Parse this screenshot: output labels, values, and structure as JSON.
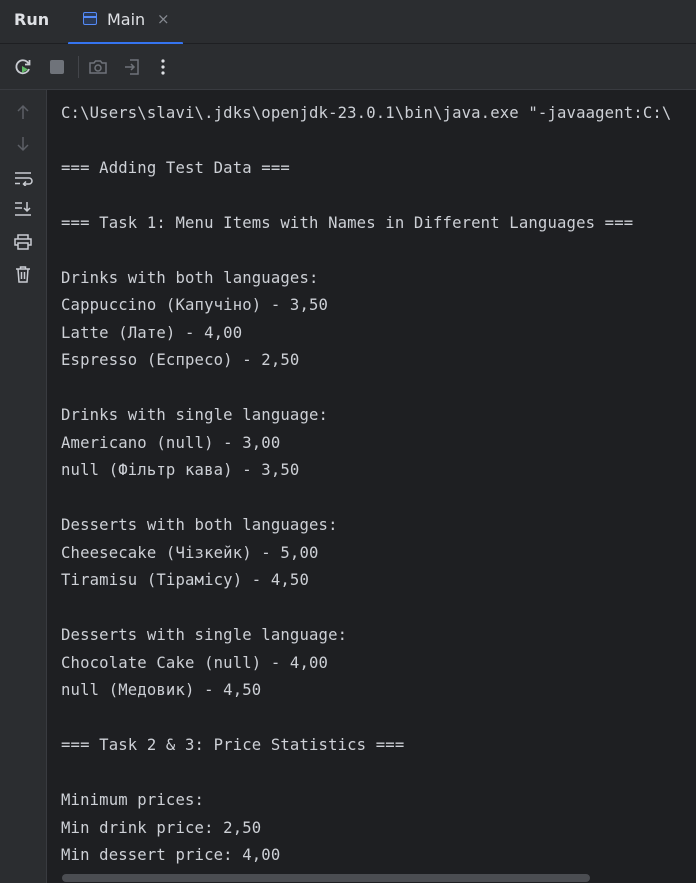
{
  "tabbar": {
    "run_label": "Run",
    "tab_label": "Main",
    "tab_close": "×"
  },
  "colors": {
    "accent": "#3574f0",
    "rerun_green": "#5fb865",
    "background": "#1e1f22",
    "panel": "#2b2d30",
    "text": "#dfe1e5"
  },
  "toolbar": {
    "icons": [
      "rerun-icon",
      "stop-icon",
      "screenshot-icon",
      "exit-icon",
      "more-icon"
    ]
  },
  "sidebar": {
    "icons": [
      "arrow-up-icon",
      "arrow-down-icon",
      "soft-wrap-icon",
      "scroll-to-end-icon",
      "print-icon",
      "trash-icon"
    ]
  },
  "console": {
    "lines": [
      "C:\\Users\\slavi\\.jdks\\openjdk-23.0.1\\bin\\java.exe \"-javaagent:C:\\",
      "",
      "=== Adding Test Data ===",
      "",
      "=== Task 1: Menu Items with Names in Different Languages ===",
      "",
      "Drinks with both languages:",
      "Cappuccino (Капучіно) - 3,50",
      "Latte (Лате) - 4,00",
      "Espresso (Еспресо) - 2,50",
      "",
      "Drinks with single language:",
      "Americano (null) - 3,00",
      "null (Фільтр кава) - 3,50",
      "",
      "Desserts with both languages:",
      "Cheesecake (Чізкейк) - 5,00",
      "Tiramisu (Тірамісу) - 4,50",
      "",
      "Desserts with single language:",
      "Chocolate Cake (null) - 4,00",
      "null (Медовик) - 4,50",
      "",
      "=== Task 2 & 3: Price Statistics ===",
      "",
      "Minimum prices:",
      "Min drink price: 2,50",
      "Min dessert price: 4,00"
    ]
  }
}
